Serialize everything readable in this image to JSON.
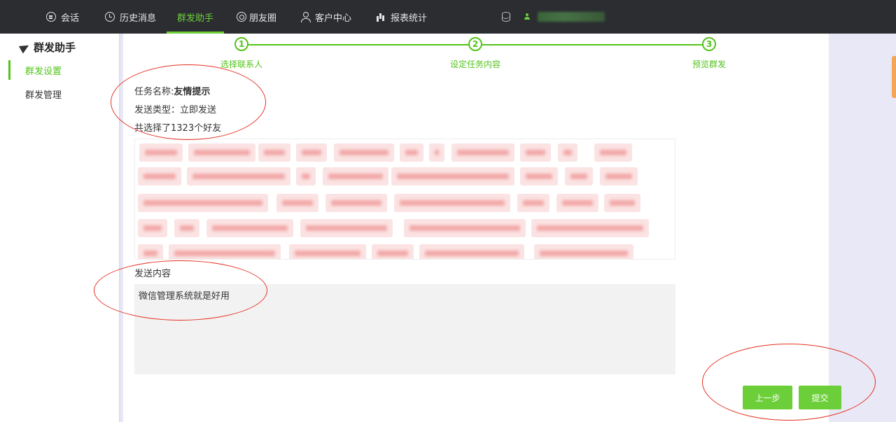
{
  "nav": {
    "items": [
      {
        "label": "会话",
        "icon": "chat-icon"
      },
      {
        "label": "历史消息",
        "icon": "clock-icon"
      },
      {
        "label": "群发助手",
        "icon": "",
        "active": true
      },
      {
        "label": "朋友圈",
        "icon": "aperture-icon"
      },
      {
        "label": "客户中心",
        "icon": "user-icon"
      },
      {
        "label": "报表统计",
        "icon": "bar-chart-icon"
      }
    ],
    "account": "(blurred account id)"
  },
  "sidebar": {
    "title": "群发助手",
    "items": [
      {
        "label": "群发设置",
        "active": true
      },
      {
        "label": "群发管理",
        "active": false
      }
    ]
  },
  "steps": [
    {
      "num": "1",
      "label": "选择联系人"
    },
    {
      "num": "2",
      "label": "设定任务内容"
    },
    {
      "num": "3",
      "label": "预览群发"
    }
  ],
  "task": {
    "name_label": "任务名称:",
    "name_value": "友情提示",
    "type_text": "发送类型：立即发送",
    "count_text": "共选择了1323个好友"
  },
  "content": {
    "label": "发送内容",
    "value": "微信管理系统就是好用"
  },
  "buttons": {
    "prev": "上一步",
    "submit": "提交"
  },
  "colors": {
    "accent": "#52c41a",
    "topbar": "#2b2d31",
    "annotation": "#e53020"
  }
}
